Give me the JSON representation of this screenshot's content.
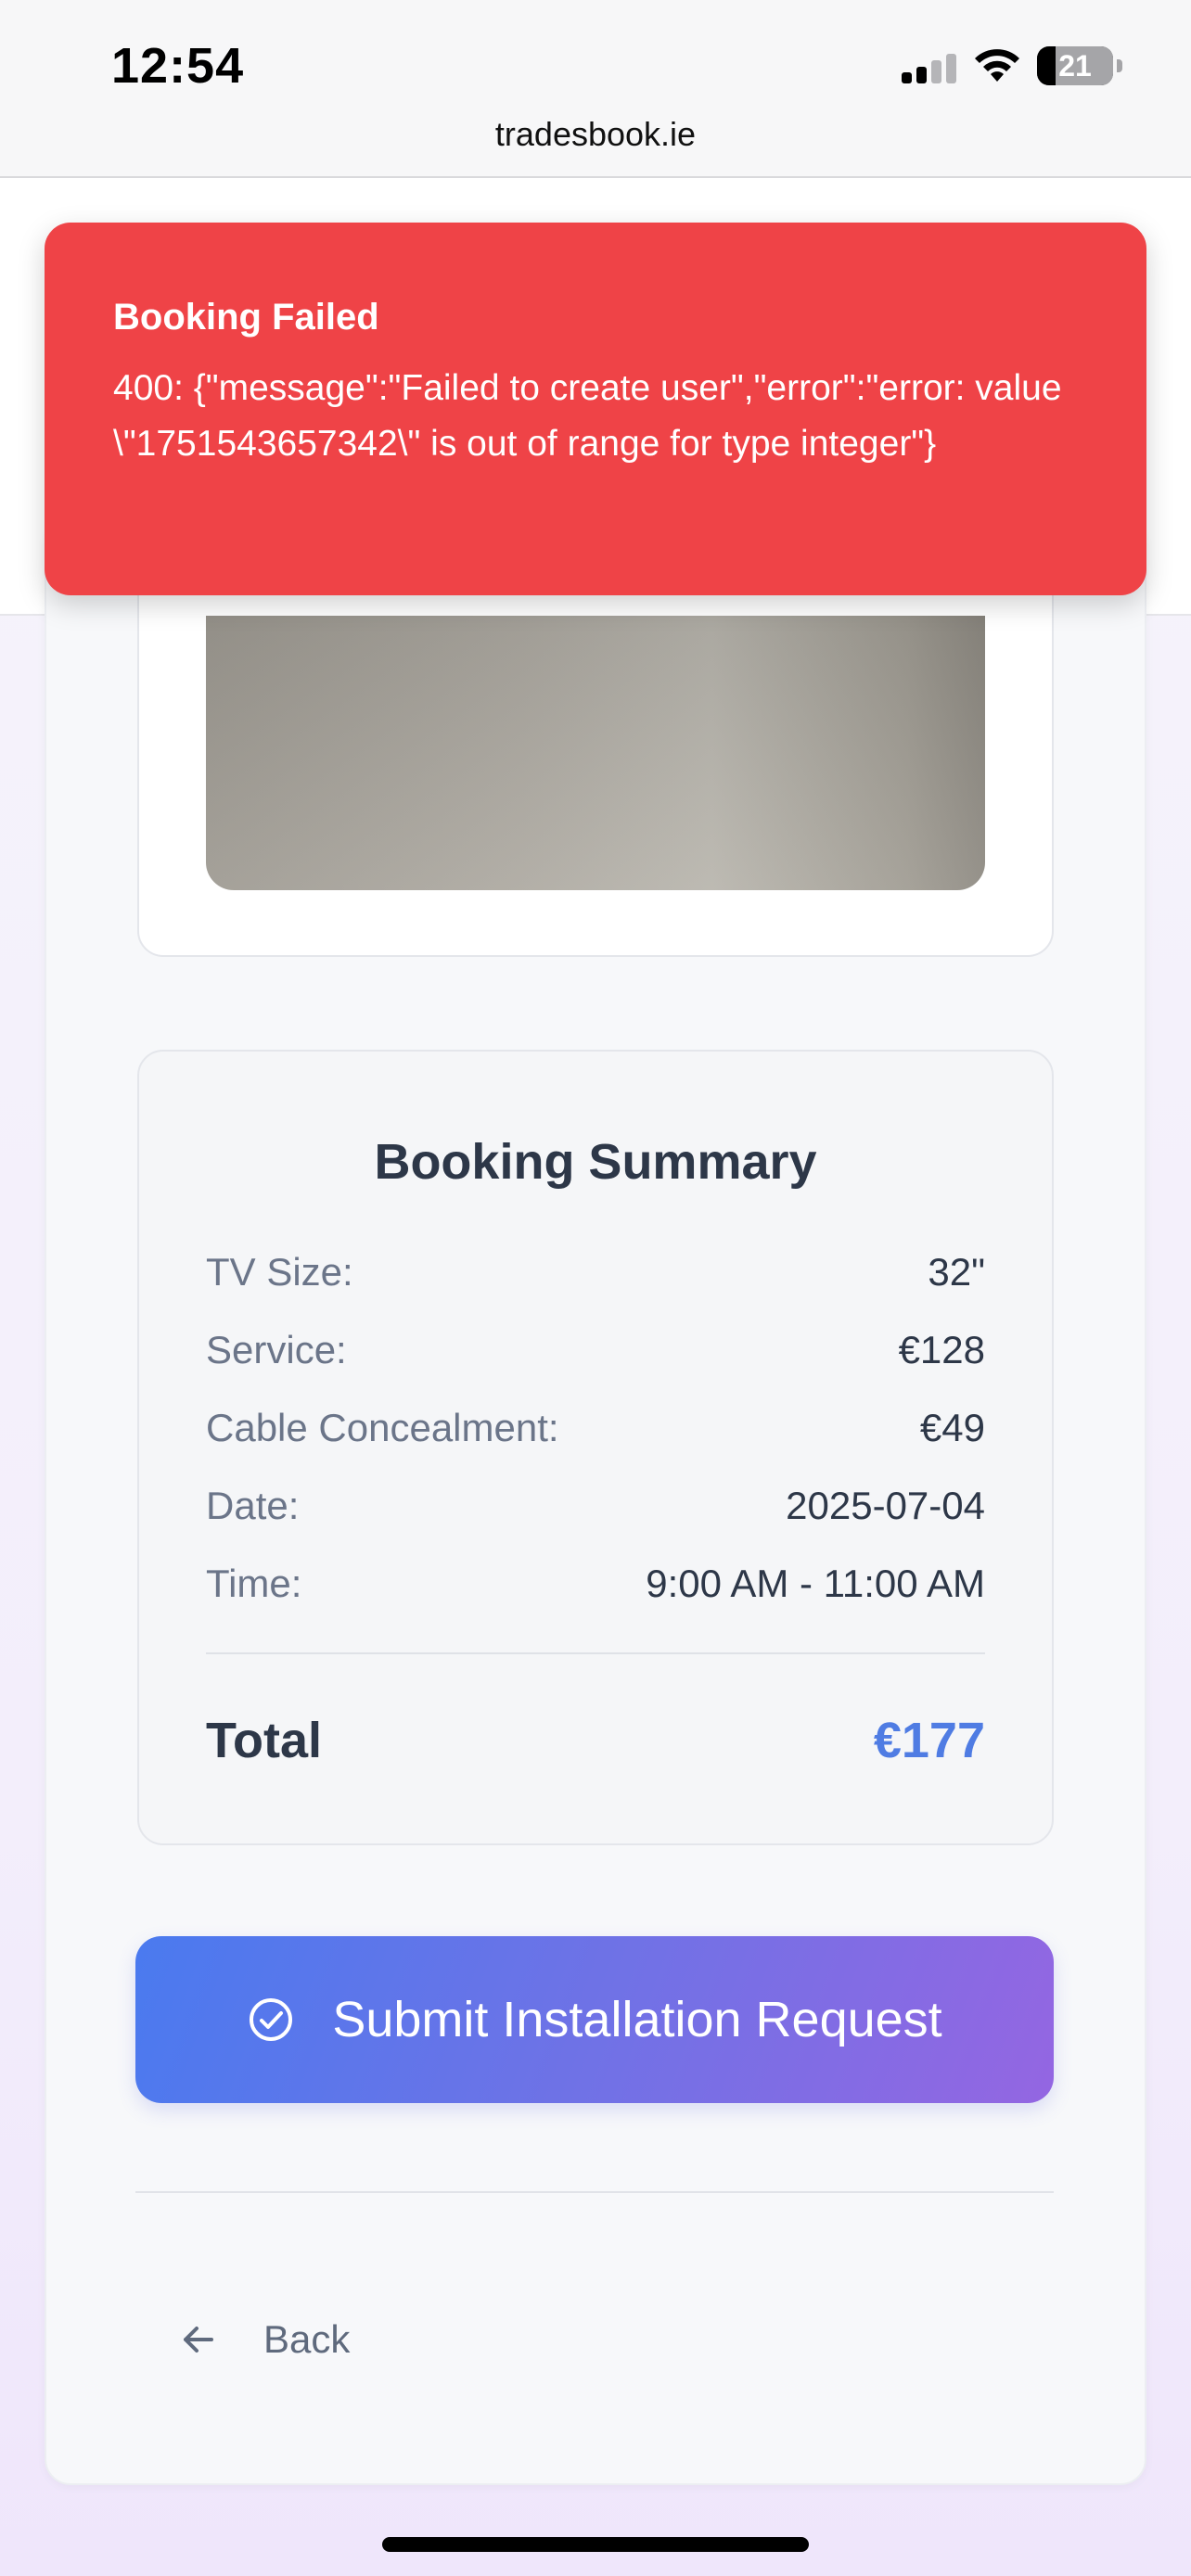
{
  "status_bar": {
    "time": "12:54",
    "battery": "21",
    "url": "tradesbook.ie",
    "icons": [
      "signal-icon",
      "wifi-icon",
      "battery-icon"
    ]
  },
  "toast": {
    "title": "Booking Failed",
    "message": "400: {\"message\":\"Failed to create user\",\"error\":\"error: value \\\"1751543657342\\\" is out of range for type integer\"}",
    "color": "#ef4347"
  },
  "summary": {
    "title": "Booking Summary",
    "rows": [
      {
        "label": "TV Size:",
        "value": "32\""
      },
      {
        "label": "Service:",
        "value": "€128"
      },
      {
        "label": "Cable Concealment:",
        "value": "€49"
      },
      {
        "label": "Date:",
        "value": "2025-07-04"
      },
      {
        "label": "Time:",
        "value": "9:00 AM - 11:00 AM"
      }
    ],
    "total_label": "Total",
    "total_value": "€177",
    "accent": "#4f7ce3"
  },
  "actions": {
    "submit_label": "Submit Installation Request",
    "back_label": "Back"
  }
}
